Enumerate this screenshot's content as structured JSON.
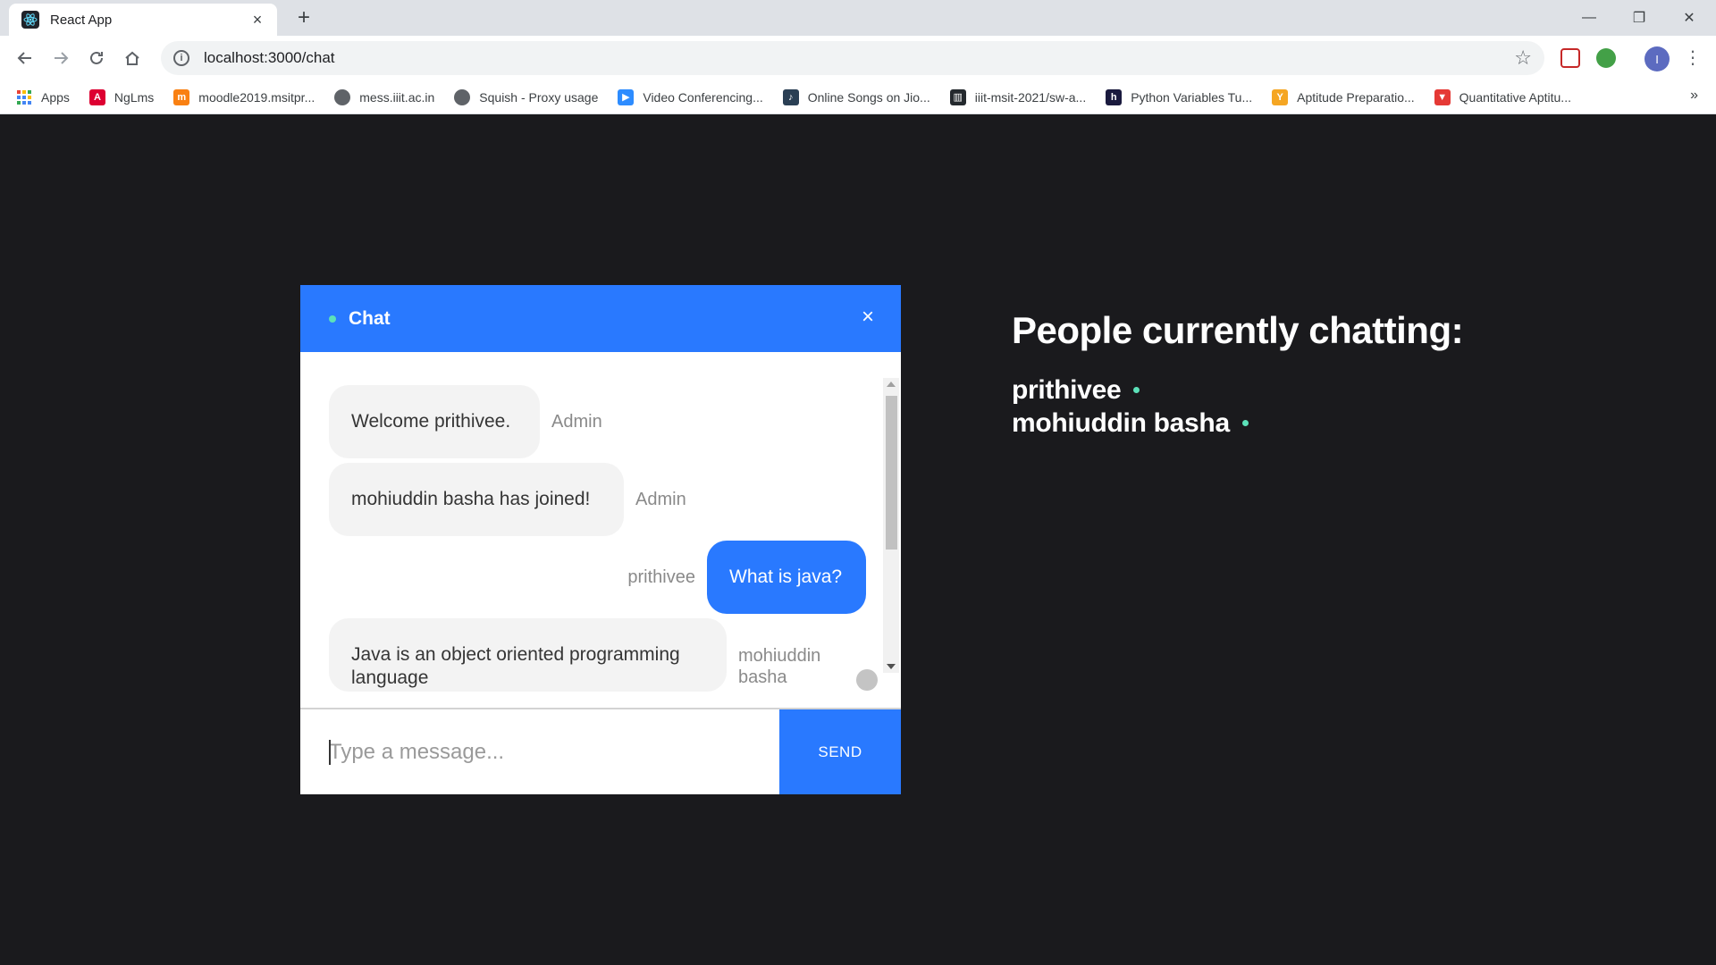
{
  "browser": {
    "tab_title": "React App",
    "tab_close": "×",
    "new_tab": "+",
    "url": "localhost:3000/chat",
    "profile_initial": "I",
    "window_controls": {
      "minimize": "—",
      "restore": "❐",
      "close": "✕"
    },
    "bookmarks": [
      {
        "label": "Apps",
        "icon": "apps-grid-icon",
        "color": "#ea4335"
      },
      {
        "label": "NgLms",
        "icon": "angular-icon",
        "color": "#dd0031"
      },
      {
        "label": "moodle2019.msitpr...",
        "icon": "moodle-icon",
        "color": "#f98012"
      },
      {
        "label": "mess.iiit.ac.in",
        "icon": "globe-icon",
        "color": "#5f6368"
      },
      {
        "label": "Squish - Proxy usage",
        "icon": "globe-icon",
        "color": "#5f6368"
      },
      {
        "label": "Video Conferencing...",
        "icon": "zoom-icon",
        "color": "#2d8cff"
      },
      {
        "label": "Online Songs on Jio...",
        "icon": "jiosaavn-icon",
        "color": "#2a3f54"
      },
      {
        "label": "iiit-msit-2021/sw-a...",
        "icon": "repo-icon",
        "color": "#24292e"
      },
      {
        "label": "Python Variables Tu...",
        "icon": "h-icon",
        "color": "#1a1a3e"
      },
      {
        "label": "Aptitude Preparatio...",
        "icon": "aptitude-icon",
        "color": "#f5a623"
      },
      {
        "label": "Quantitative Aptitu...",
        "icon": "quant-icon",
        "color": "#e53935"
      }
    ],
    "bookmarks_more": "»"
  },
  "chat": {
    "title": "Chat",
    "close_symbol": "×",
    "messages": [
      {
        "text": "Welcome prithivee.",
        "sender": "Admin",
        "mine": false
      },
      {
        "text": "mohiuddin basha has joined!",
        "sender": "Admin",
        "mine": false
      },
      {
        "text": "What is java?",
        "sender": "prithivee",
        "mine": true
      },
      {
        "text": "Java is an object oriented programming language",
        "sender": "mohiuddin basha",
        "mine": false
      }
    ],
    "input_placeholder": "Type a message...",
    "input_value": "",
    "send_label": "SEND"
  },
  "people": {
    "title": "People currently chatting:",
    "users": [
      "prithivee",
      "mohiuddin basha"
    ]
  },
  "colors": {
    "accent": "#2979ff",
    "online": "#5ce1b9",
    "page_bg": "#1a1a1d"
  }
}
